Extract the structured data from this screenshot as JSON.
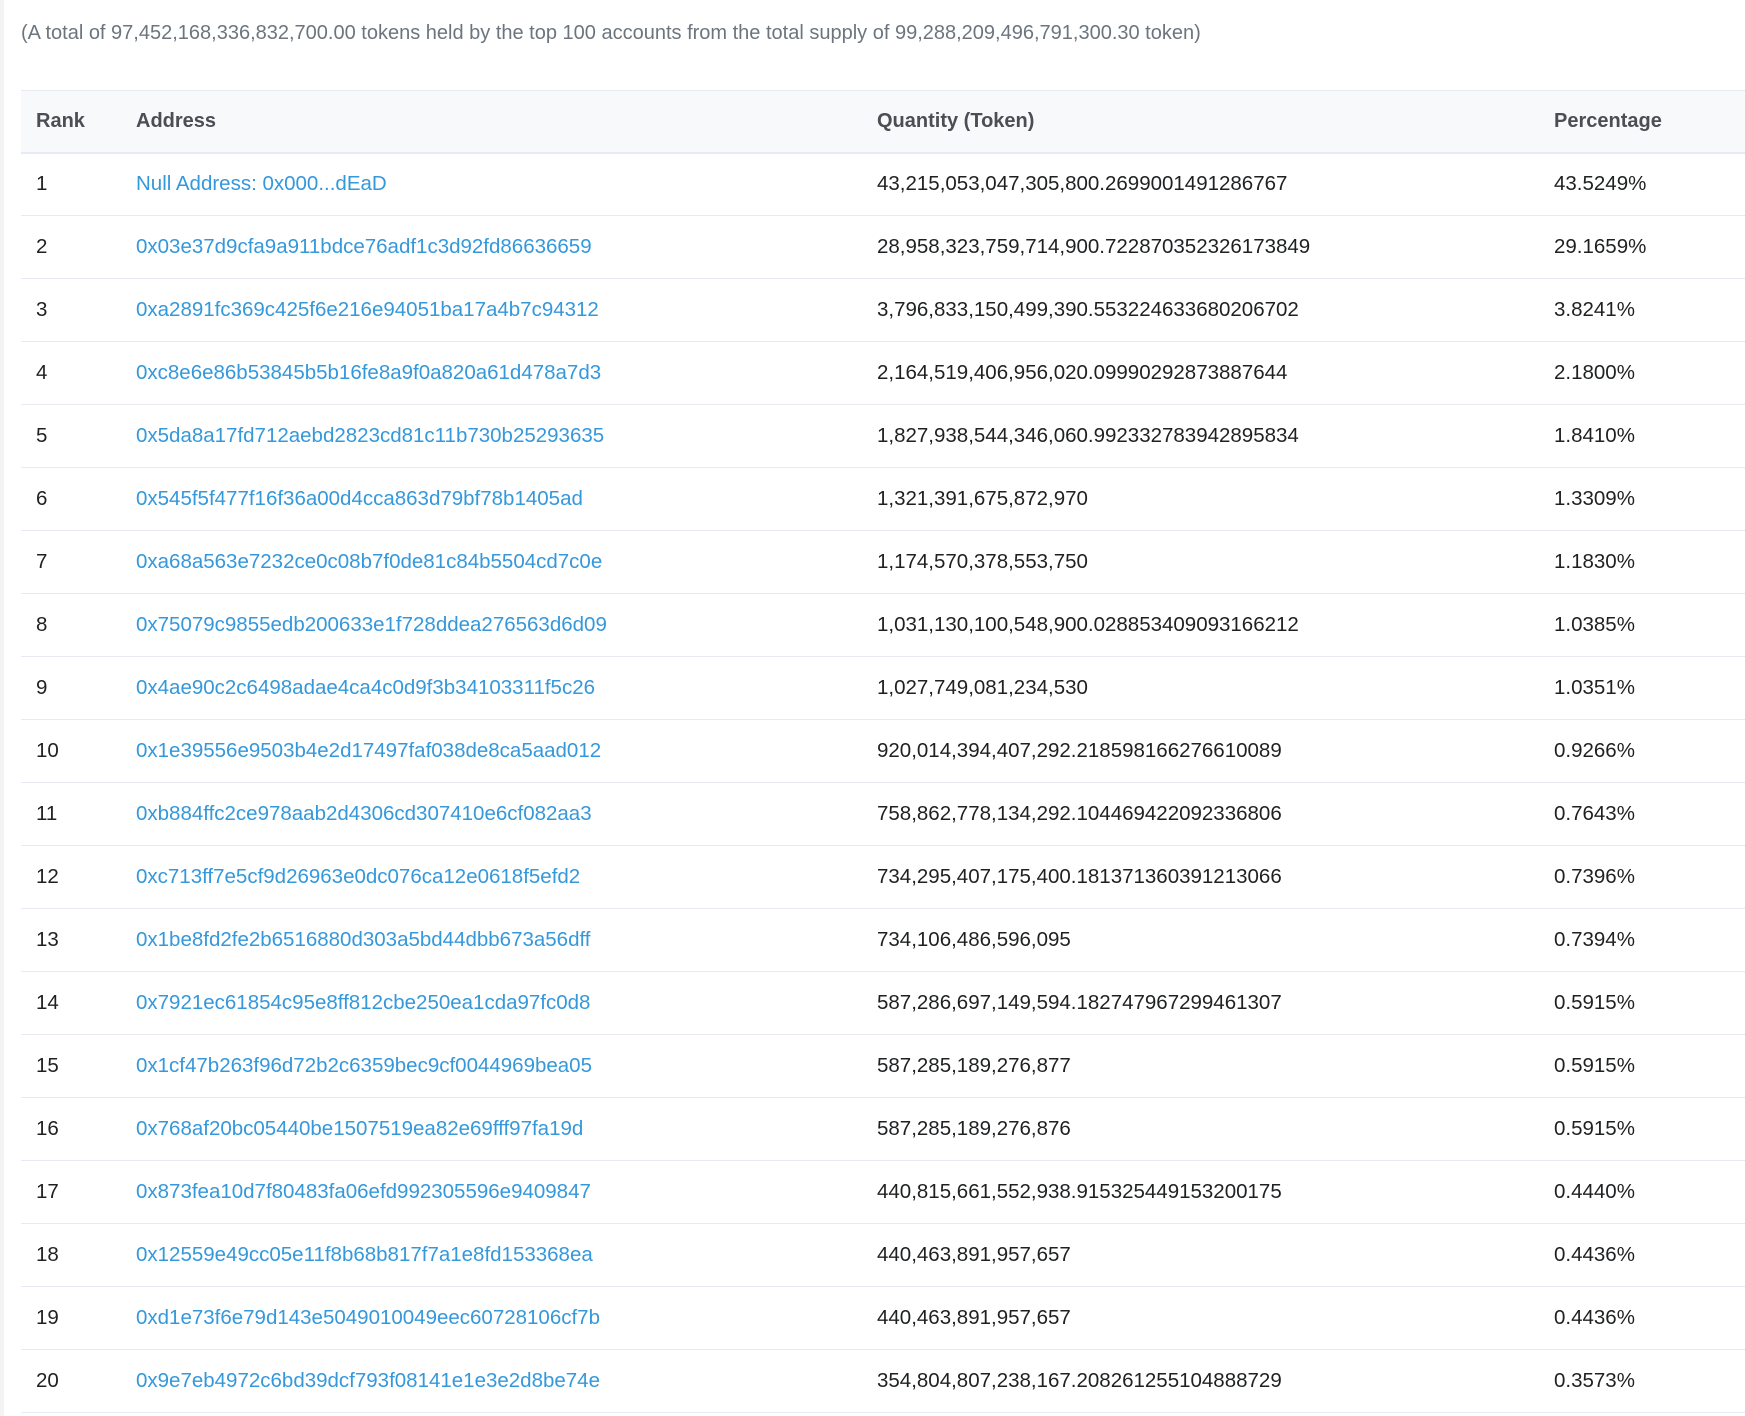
{
  "summary": "(A total of 97,452,168,336,832,700.00 tokens held by the top 100 accounts from the total supply of 99,288,209,496,791,300.30 token)",
  "table": {
    "headers": {
      "rank": "Rank",
      "address": "Address",
      "quantity": "Quantity (Token)",
      "percentage": "Percentage"
    },
    "rows": [
      {
        "rank": "1",
        "address": "Null Address: 0x000...dEaD",
        "quantity": "43,215,053,047,305,800.2699001491286767",
        "percentage": "43.5249%"
      },
      {
        "rank": "2",
        "address": "0x03e37d9cfa9a911bdce76adf1c3d92fd86636659",
        "quantity": "28,958,323,759,714,900.722870352326173849",
        "percentage": "29.1659%"
      },
      {
        "rank": "3",
        "address": "0xa2891fc369c425f6e216e94051ba17a4b7c94312",
        "quantity": "3,796,833,150,499,390.553224633680206702",
        "percentage": "3.8241%"
      },
      {
        "rank": "4",
        "address": "0xc8e6e86b53845b5b16fe8a9f0a820a61d478a7d3",
        "quantity": "2,164,519,406,956,020.09990292873887644",
        "percentage": "2.1800%"
      },
      {
        "rank": "5",
        "address": "0x5da8a17fd712aebd2823cd81c11b730b25293635",
        "quantity": "1,827,938,544,346,060.992332783942895834",
        "percentage": "1.8410%"
      },
      {
        "rank": "6",
        "address": "0x545f5f477f16f36a00d4cca863d79bf78b1405ad",
        "quantity": "1,321,391,675,872,970",
        "percentage": "1.3309%"
      },
      {
        "rank": "7",
        "address": "0xa68a563e7232ce0c08b7f0de81c84b5504cd7c0e",
        "quantity": "1,174,570,378,553,750",
        "percentage": "1.1830%"
      },
      {
        "rank": "8",
        "address": "0x75079c9855edb200633e1f728ddea276563d6d09",
        "quantity": "1,031,130,100,548,900.028853409093166212",
        "percentage": "1.0385%"
      },
      {
        "rank": "9",
        "address": "0x4ae90c2c6498adae4ca4c0d9f3b34103311f5c26",
        "quantity": "1,027,749,081,234,530",
        "percentage": "1.0351%"
      },
      {
        "rank": "10",
        "address": "0x1e39556e9503b4e2d17497faf038de8ca5aad012",
        "quantity": "920,014,394,407,292.218598166276610089",
        "percentage": "0.9266%"
      },
      {
        "rank": "11",
        "address": "0xb884ffc2ce978aab2d4306cd307410e6cf082aa3",
        "quantity": "758,862,778,134,292.104469422092336806",
        "percentage": "0.7643%"
      },
      {
        "rank": "12",
        "address": "0xc713ff7e5cf9d26963e0dc076ca12e0618f5efd2",
        "quantity": "734,295,407,175,400.181371360391213066",
        "percentage": "0.7396%"
      },
      {
        "rank": "13",
        "address": "0x1be8fd2fe2b6516880d303a5bd44dbb673a56dff",
        "quantity": "734,106,486,596,095",
        "percentage": "0.7394%"
      },
      {
        "rank": "14",
        "address": "0x7921ec61854c95e8ff812cbe250ea1cda97fc0d8",
        "quantity": "587,286,697,149,594.182747967299461307",
        "percentage": "0.5915%"
      },
      {
        "rank": "15",
        "address": "0x1cf47b263f96d72b2c6359bec9cf0044969bea05",
        "quantity": "587,285,189,276,877",
        "percentage": "0.5915%"
      },
      {
        "rank": "16",
        "address": "0x768af20bc05440be1507519ea82e69fff97fa19d",
        "quantity": "587,285,189,276,876",
        "percentage": "0.5915%"
      },
      {
        "rank": "17",
        "address": "0x873fea10d7f80483fa06efd992305596e9409847",
        "quantity": "440,815,661,552,938.915325449153200175",
        "percentage": "0.4440%"
      },
      {
        "rank": "18",
        "address": "0x12559e49cc05e11f8b68b817f7a1e8fd153368ea",
        "quantity": "440,463,891,957,657",
        "percentage": "0.4436%"
      },
      {
        "rank": "19",
        "address": "0xd1e73f6e79d143e5049010049eec60728106cf7b",
        "quantity": "440,463,891,957,657",
        "percentage": "0.4436%"
      },
      {
        "rank": "20",
        "address": "0x9e7eb4972c6bd39dcf793f08141e1e3e2d8be74e",
        "quantity": "354,804,807,238,167.208261255104888729",
        "percentage": "0.3573%"
      }
    ]
  },
  "colors": {
    "link": "#3498db",
    "text": "#1e2022",
    "muted": "#6c757e",
    "header_bg": "#f8f9fa",
    "border": "#e7eaf3"
  }
}
